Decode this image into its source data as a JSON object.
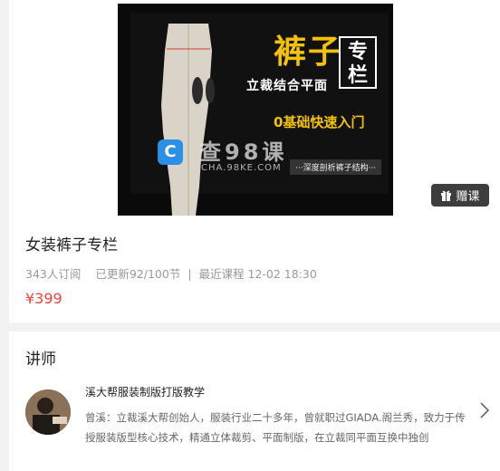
{
  "cover": {
    "title": "裤子",
    "badge": "专栏",
    "subtitle": "立裁结合平面",
    "intro": "0基础快速入门",
    "tag": "···深度剖析裤子结构···",
    "watermark_text": "查98课",
    "watermark_domain": "CHA.98KE.COM",
    "watermark_logo": "C"
  },
  "gift_button": {
    "label": "赠课",
    "icon": "gift-icon"
  },
  "course": {
    "title": "女装裤子专栏",
    "subscribers": "343人订阅",
    "updated": "已更新92/100节",
    "separator": "|",
    "recent": "最近课程 12-02 18:30",
    "price": "¥399"
  },
  "teacher": {
    "heading": "讲师",
    "name": "溪大帮服装制版打版教学",
    "bio": "曾溪：立裁溪大帮创始人，服装行业二十多年，曾就职过GIADA.阁兰秀，致力于传授服装版型核心技术，精通立体裁剪、平面制版，在立裁同平面互换中独创",
    "avatar": "avatar",
    "chevron": "chevron-right-icon"
  },
  "colors": {
    "price": "#e8453c",
    "cover_accent": "#f3c200",
    "gift_bg": "#3d3d3d"
  }
}
